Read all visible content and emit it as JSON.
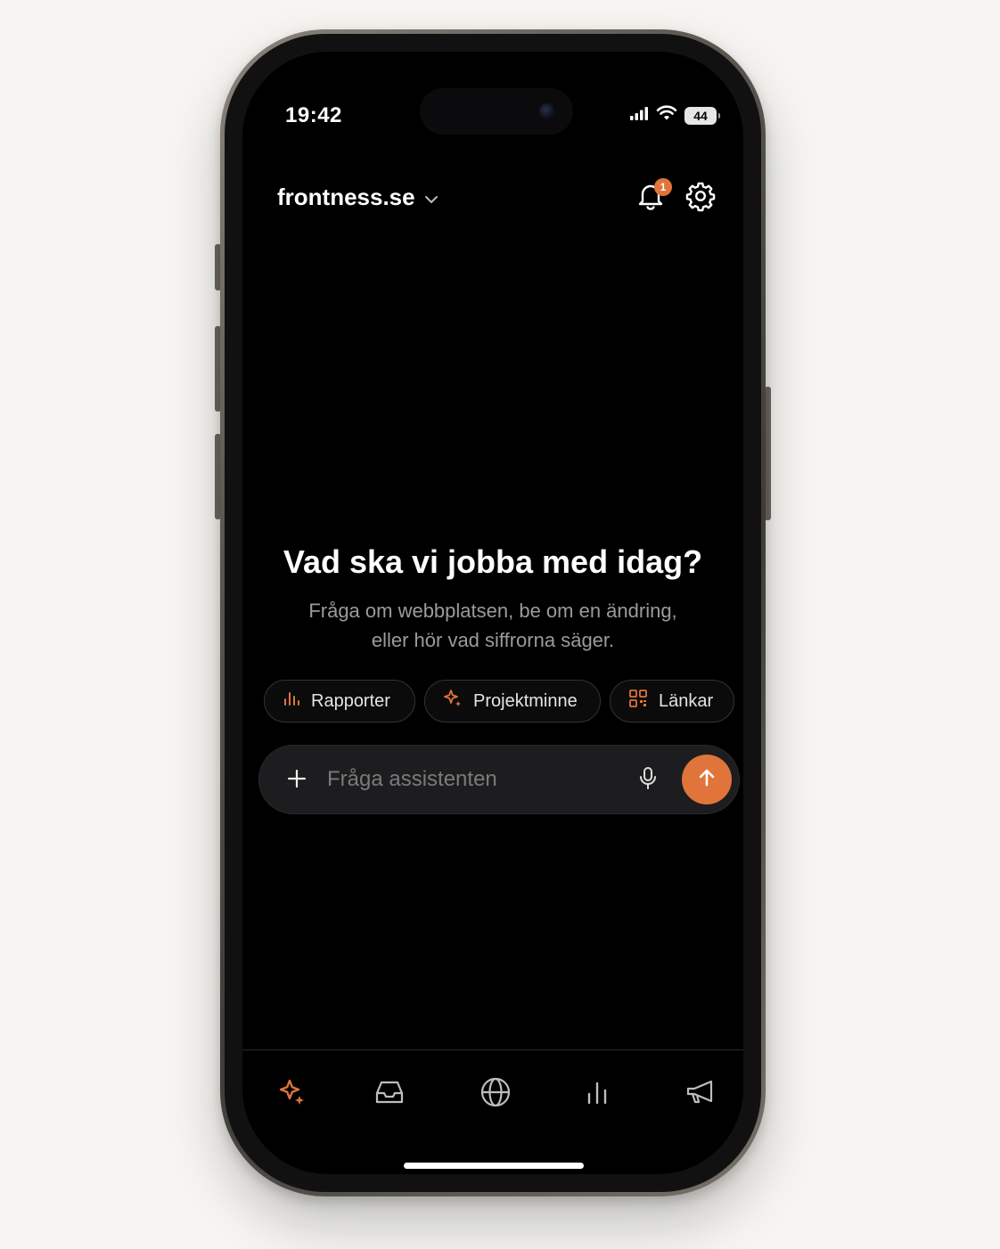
{
  "status_bar": {
    "time": "19:42",
    "battery": "44",
    "icons": [
      "cellular-signal-icon",
      "wifi-icon",
      "battery-icon"
    ]
  },
  "header": {
    "site_name": "frontness.se",
    "notification_count": "1",
    "icons": [
      "chevron-down-icon",
      "bell-icon",
      "gear-icon"
    ]
  },
  "hero": {
    "title": "Vad ska vi jobba med idag?",
    "subtitle_line1": "Fråga om webbplatsen, be om en ändring,",
    "subtitle_line2": "eller hör vad siffrorna säger."
  },
  "chips": [
    {
      "label": "Rapporter",
      "icon": "bar-chart-icon"
    },
    {
      "label": "Projektminne",
      "icon": "sparkle-icon"
    },
    {
      "label": "Länkar",
      "icon": "qr-code-icon"
    }
  ],
  "composer": {
    "placeholder": "Fråga assistenten",
    "value": "",
    "icons": [
      "plus-icon",
      "microphone-icon",
      "arrow-up-icon"
    ]
  },
  "tabbar": {
    "tabs": [
      {
        "icon": "sparkle-icon",
        "active": true
      },
      {
        "icon": "inbox-icon",
        "active": false
      },
      {
        "icon": "globe-icon",
        "active": false
      },
      {
        "icon": "bar-chart-icon",
        "active": false
      },
      {
        "icon": "megaphone-icon",
        "active": false
      }
    ]
  },
  "colors": {
    "accent": "#e0743a",
    "background": "#000000",
    "page": "#f6f5f1",
    "muted_text": "#9b9b9b"
  }
}
